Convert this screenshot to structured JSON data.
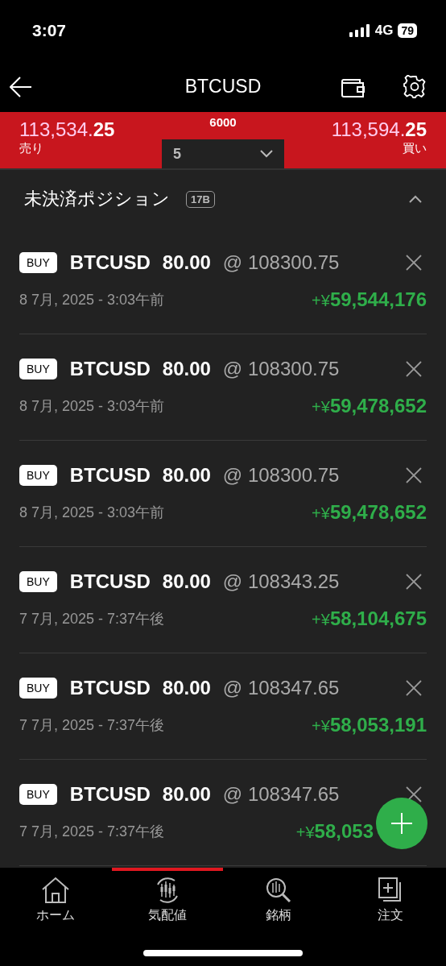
{
  "status_bar": {
    "time": "3:07",
    "network": "4G",
    "battery": "79"
  },
  "header": {
    "title": "BTCUSD"
  },
  "quote": {
    "sell_price": "113,534.",
    "sell_price_tail": "25",
    "sell_label": "売り",
    "spread": "6000",
    "lot": "5",
    "buy_price": "113,594.",
    "buy_price_tail": "25",
    "buy_label": "買い"
  },
  "section": {
    "title": "未決済ポジション",
    "badge": "17B",
    "expanded": true
  },
  "positions": [
    {
      "side": "BUY",
      "symbol": "BTCUSD",
      "volume": "80.00",
      "price": "@ 108300.75",
      "date": "8 7月, 2025 - 3:03午前",
      "profit_sign": "+¥",
      "profit": "59,544,176"
    },
    {
      "side": "BUY",
      "symbol": "BTCUSD",
      "volume": "80.00",
      "price": "@ 108300.75",
      "date": "8 7月, 2025 - 3:03午前",
      "profit_sign": "+¥",
      "profit": "59,478,652"
    },
    {
      "side": "BUY",
      "symbol": "BTCUSD",
      "volume": "80.00",
      "price": "@ 108300.75",
      "date": "8 7月, 2025 - 3:03午前",
      "profit_sign": "+¥",
      "profit": "59,478,652"
    },
    {
      "side": "BUY",
      "symbol": "BTCUSD",
      "volume": "80.00",
      "price": "@ 108343.25",
      "date": "7 7月, 2025 - 7:37午後",
      "profit_sign": "+¥",
      "profit": "58,104,675"
    },
    {
      "side": "BUY",
      "symbol": "BTCUSD",
      "volume": "80.00",
      "price": "@ 108347.65",
      "date": "7 7月, 2025 - 7:37午後",
      "profit_sign": "+¥",
      "profit": "58,053,191"
    },
    {
      "side": "BUY",
      "symbol": "BTCUSD",
      "volume": "80.00",
      "price": "@ 108347.65",
      "date": "7 7月, 2025 - 7:37午後",
      "profit_sign": "+¥",
      "profit": "58,053"
    }
  ],
  "nav": [
    {
      "label": "ホーム",
      "kind": "home",
      "selected": false
    },
    {
      "label": "気配値",
      "kind": "quotes",
      "selected": true
    },
    {
      "label": "銘柄",
      "kind": "search",
      "selected": false
    },
    {
      "label": "注文",
      "kind": "order",
      "selected": false
    }
  ]
}
